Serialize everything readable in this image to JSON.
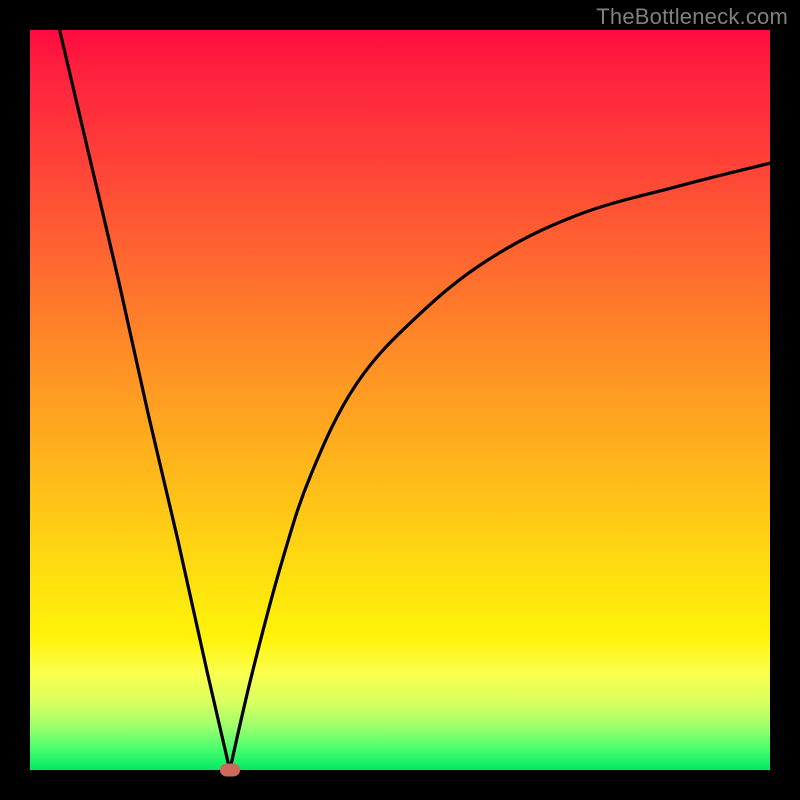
{
  "watermark": "TheBottleneck.com",
  "colors": {
    "frame": "#000000",
    "curve": "#000000",
    "marker": "#cc6a5c",
    "gradient_stops": [
      "#ff0b3f",
      "#ff4238",
      "#ff9324",
      "#ffdd10",
      "#fbff4e",
      "#4eff6e",
      "#00e864"
    ]
  },
  "chart_data": {
    "type": "line",
    "title": "",
    "xlabel": "",
    "ylabel": "",
    "xlim": [
      0,
      100
    ],
    "ylim": [
      0,
      100
    ],
    "notes": "V-shaped bottleneck curve. Minimum (optimal, zero bottleneck) at x≈27. Left branch is near-linear descending from top-left; right branch rises with decreasing slope toward upper-right. Background is a vertical red→green gradient (green = low bottleneck). A small rounded marker sits at the minimum.",
    "series": [
      {
        "name": "left-branch",
        "x": [
          4,
          8,
          12,
          16,
          20,
          24,
          27
        ],
        "values": [
          100,
          83,
          66,
          48,
          31,
          13,
          0
        ]
      },
      {
        "name": "right-branch",
        "x": [
          27,
          30,
          34,
          38,
          44,
          52,
          62,
          74,
          88,
          100
        ],
        "values": [
          0,
          13,
          28,
          40,
          52,
          61,
          69,
          75,
          79,
          82
        ]
      }
    ],
    "marker": {
      "x": 27,
      "y": 0
    }
  }
}
